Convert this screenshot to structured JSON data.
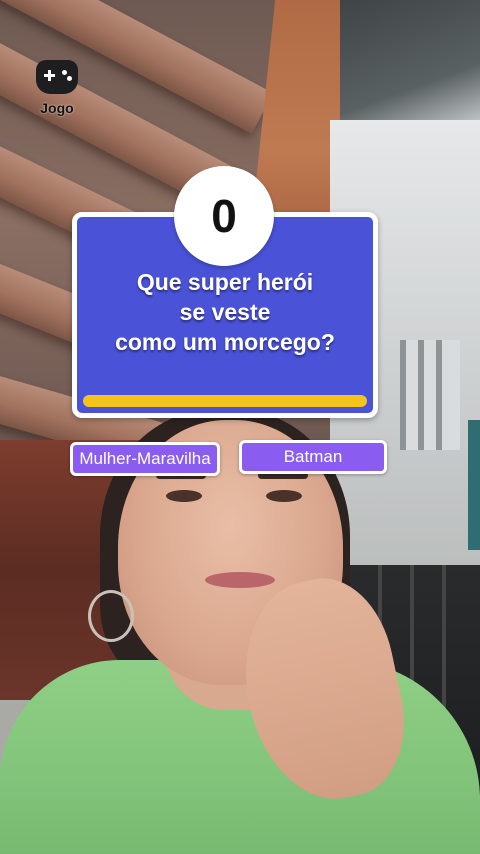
{
  "effect": {
    "badge_label": "Jogo",
    "badge_icon": "gamepad-icon"
  },
  "quiz": {
    "score": "0",
    "question_lines": [
      "Que super herói",
      "se veste",
      "como um morcego?"
    ],
    "answers": [
      "Mulher-Maravilha",
      "Batman"
    ],
    "timer_progress": 1.0
  },
  "colors": {
    "card": "#4a52d8",
    "answer_button": "#8a5cf0",
    "timer": "#f6c21e"
  }
}
